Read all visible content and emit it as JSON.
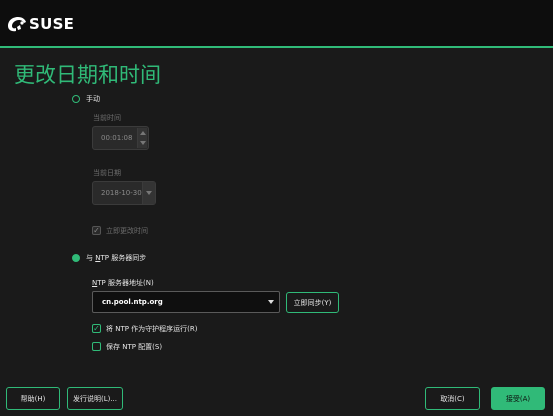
{
  "header": {
    "logo_text": "SUSE"
  },
  "page": {
    "title": "更改日期和时间"
  },
  "manual": {
    "label": "手动",
    "time_label": "当前时间",
    "time_value": "00:01:08",
    "date_label": "当前日期",
    "date_value": "2018-10-30",
    "change_now_label": "立即更改时间",
    "change_now_checked": true
  },
  "ntp": {
    "label_prefix": "与 ",
    "label_mnemonic": "N",
    "label_rest": "TP 服务器同步",
    "server_label_mnemonic": "N",
    "server_label_rest": "TP 服务器地址(N)",
    "server_value": "cn.pool.ntp.org",
    "sync_now_label": "立即同步(Y)",
    "daemon_label": "将 NTP 作为守护程序运行(R)",
    "daemon_checked": true,
    "save_label": "保存 NTP 配置(S)",
    "save_checked": false
  },
  "footer": {
    "help_label": "帮助(H)",
    "release_notes_label": "发行说明(L)...",
    "cancel_label": "取消(C)",
    "accept_label": "接受(A)"
  },
  "colors": {
    "accent": "#30ba78",
    "background": "#1a1a1a",
    "header": "#0d0d0d"
  }
}
